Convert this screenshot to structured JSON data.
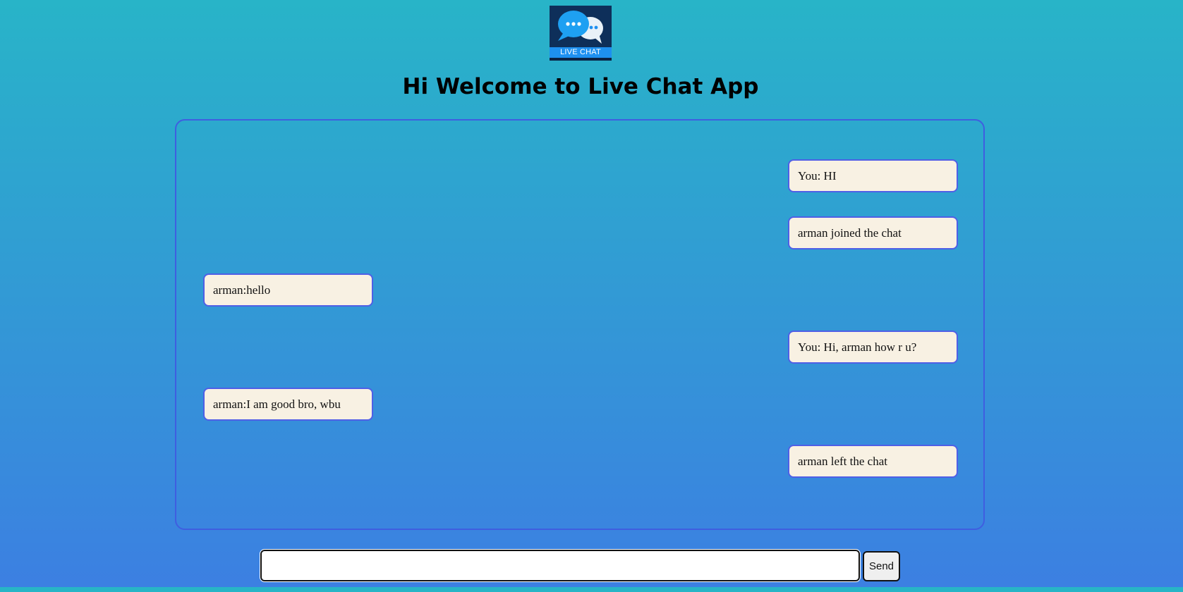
{
  "logo": {
    "label": "LIVE CHAT",
    "icon": "chat-bubbles-icon"
  },
  "header": {
    "title": "Hi Welcome to Live Chat App"
  },
  "chat": {
    "messages": [
      {
        "side": "right",
        "text": "You: HI"
      },
      {
        "side": "right",
        "text": "arman joined the chat"
      },
      {
        "side": "left",
        "text": "arman:hello"
      },
      {
        "side": "right",
        "text": "You: Hi, arman how r u?"
      },
      {
        "side": "left",
        "text": "arman:I am good bro, wbu"
      },
      {
        "side": "right",
        "text": "arman left the chat"
      }
    ]
  },
  "composer": {
    "value": "",
    "placeholder": "",
    "send_label": "Send"
  },
  "colors": {
    "gradient_top": "#28b4c8",
    "gradient_bottom": "#3c7fe2",
    "panel_border": "#3f5ee0",
    "bubble_bg": "#f8f1e3",
    "bubble_border": "#4f5fe6"
  }
}
